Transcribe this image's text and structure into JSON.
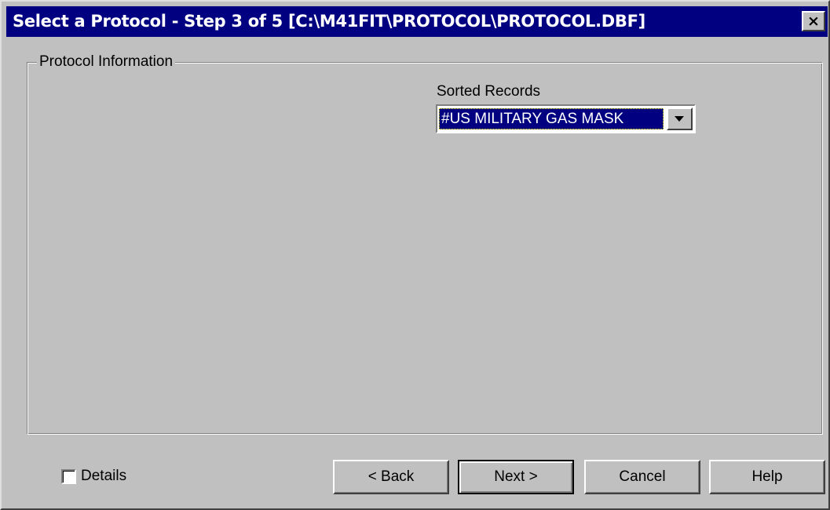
{
  "window": {
    "title": "Select a Protocol - Step 3 of 5 [C:\\M41FIT\\PROTOCOL\\PROTOCOL.DBF]",
    "close_label": "×"
  },
  "group": {
    "label": "Protocol Information"
  },
  "sorted_records": {
    "label": "Sorted Records",
    "selected_value": "#US MILITARY GAS MASK"
  },
  "details": {
    "label": "Details",
    "checked": false
  },
  "buttons": {
    "back": "< Back",
    "next": "Next >",
    "cancel": "Cancel",
    "help": "Help"
  },
  "colors": {
    "titlebar": "#000080",
    "dialog_face": "#c0c0c0",
    "selection": "#000080"
  }
}
